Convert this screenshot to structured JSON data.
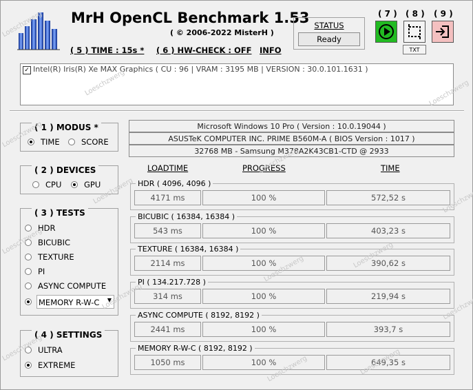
{
  "header": {
    "title": "MrH OpenCL Benchmark 1.53",
    "copyright": "( ©  2006-2022 MisterH )",
    "time_link": "( 5 ) TIME : 15s *",
    "hwcheck_link": "( 6 ) HW-CHECK : OFF",
    "info_link": "INFO"
  },
  "status": {
    "label": "STATUS",
    "value": "Ready"
  },
  "buttons": {
    "n7": "( 7 )",
    "n8": "( 8 )",
    "n9": "( 9 )",
    "txt": "TXT"
  },
  "device": {
    "name": "Intel(R) Iris(R) Xe MAX Graphics ( CU : 96 | VRAM : 3195 MB | VERSION : 30.0.101.1631 )",
    "checked": true
  },
  "modus": {
    "title": "( 1 ) MODUS *",
    "options": [
      "TIME",
      "SCORE"
    ],
    "selected": "TIME"
  },
  "devices": {
    "title": "( 2 ) DEVICES",
    "options": [
      "CPU",
      "GPU"
    ],
    "selected": "GPU"
  },
  "tests": {
    "title": "( 3 ) TESTS",
    "options": [
      "HDR",
      "BICUBIC",
      "TEXTURE",
      "PI",
      "ASYNC COMPUTE"
    ],
    "dropdown_value": "MEMORY R-W-C",
    "selected": "MEMORY R-W-C"
  },
  "settings": {
    "title": "( 4 ) SETTINGS",
    "options": [
      "ULTRA",
      "EXTREME"
    ],
    "selected": "EXTREME"
  },
  "system": {
    "os": "Microsoft Windows 10 Pro ( Version : 10.0.19044 )",
    "board": "ASUSTeK COMPUTER INC. PRIME B560M-A ( BIOS Version : 1017 )",
    "memory": "32768 MB - Samsung M378A2K43CB1-CTD     @ 2933"
  },
  "columns": {
    "loadtime": "LOADTIME",
    "progress": "PROGRESS",
    "time": "TIME"
  },
  "results": [
    {
      "name": "HDR ( 4096, 4096 )",
      "loadtime": "4171 ms",
      "progress": "100 %",
      "time": "572,52  s"
    },
    {
      "name": "BICUBIC ( 16384, 16384 )",
      "loadtime": "543 ms",
      "progress": "100 %",
      "time": "403,23  s"
    },
    {
      "name": "TEXTURE ( 16384, 16384 )",
      "loadtime": "2114 ms",
      "progress": "100 %",
      "time": "390,62  s"
    },
    {
      "name": "PI ( 134.217.728 )",
      "loadtime": "314 ms",
      "progress": "100 %",
      "time": "219,94  s"
    },
    {
      "name": "ASYNC COMPUTE ( 8192, 8192 )",
      "loadtime": "2441 ms",
      "progress": "100 %",
      "time": "393,7  s"
    },
    {
      "name": "MEMORY R-W-C ( 8192, 8192 )",
      "loadtime": "1050 ms",
      "progress": "100 %",
      "time": "649,35  s"
    }
  ],
  "watermark": "Loeschzwerg",
  "colors": {
    "start_button": "#22bb22",
    "export_button": "#f4c0c0"
  }
}
